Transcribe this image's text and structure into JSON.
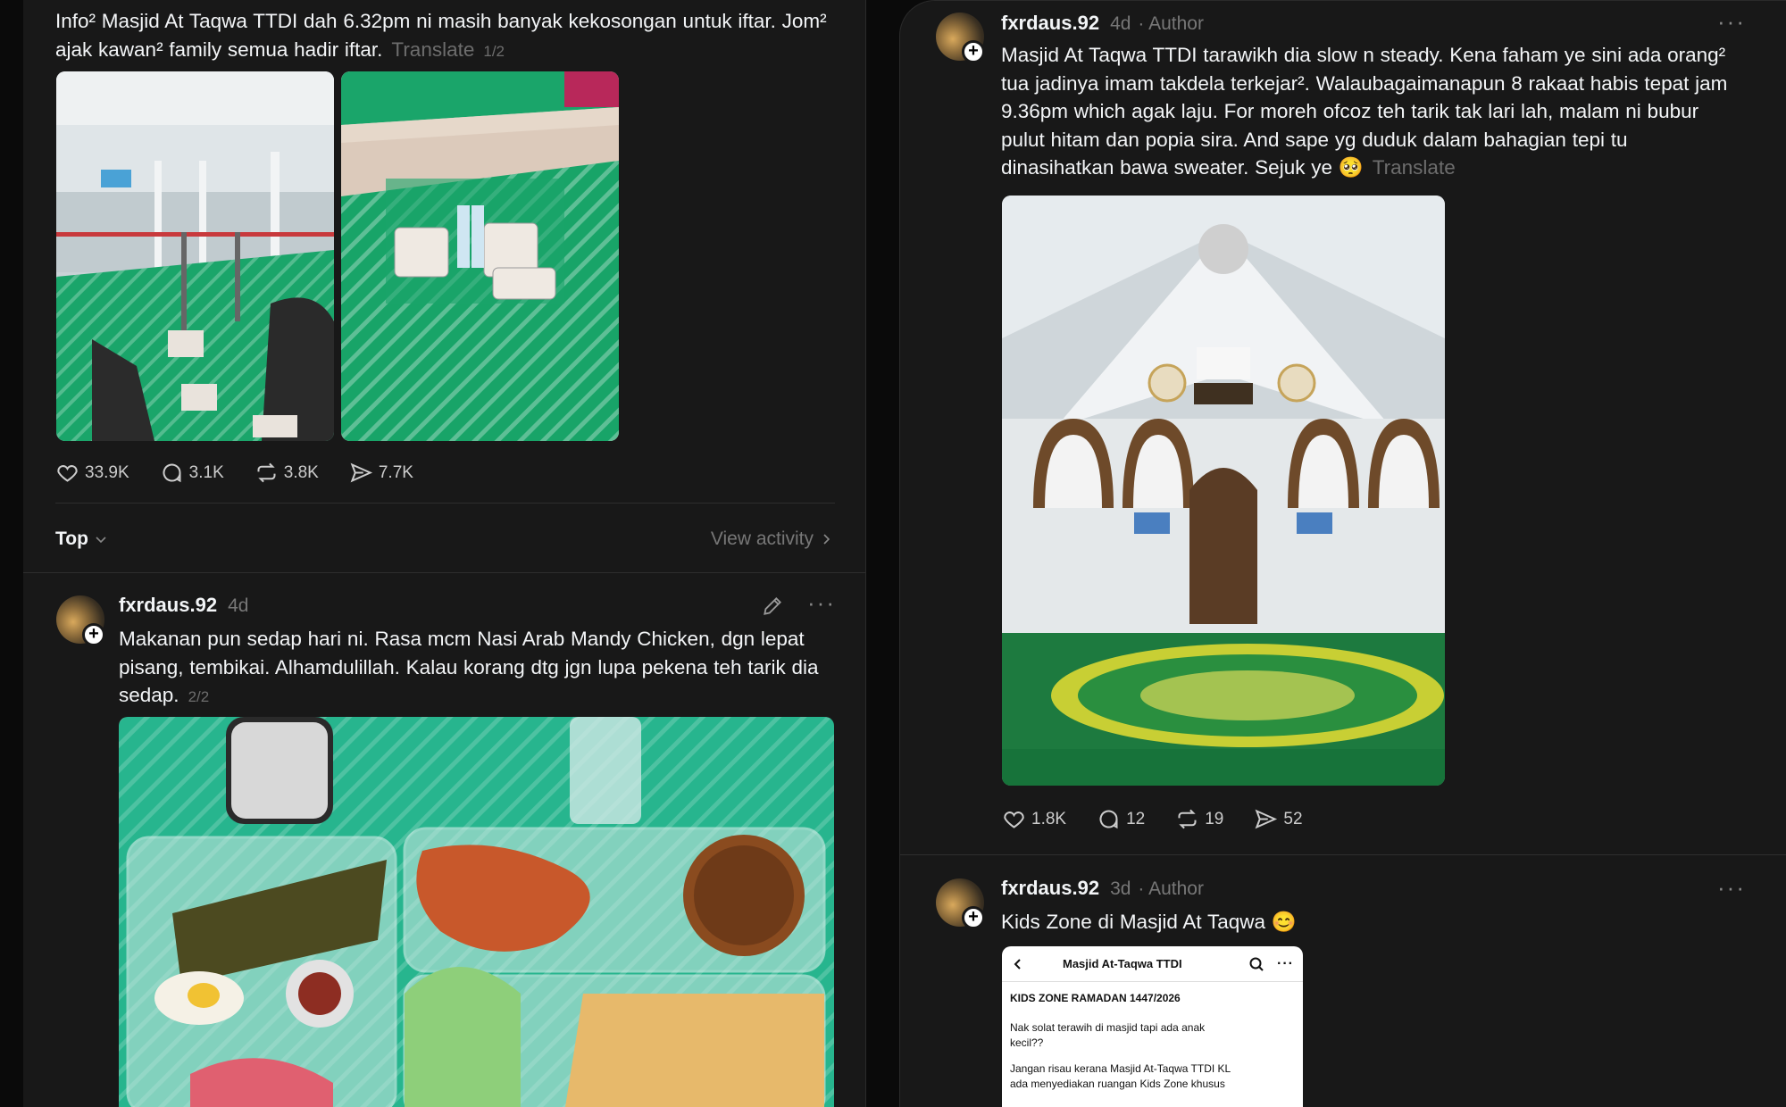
{
  "posts": {
    "p1": {
      "text_l1": "Info² Masjid At Taqwa TTDI dah 6.32pm ni masih banyak kekosongan untuk iftar. Jom²",
      "text_l2": "ajak kawan² family semua hadir iftar.",
      "translate": "Translate",
      "page": "1/2",
      "likes": "33.9K",
      "comments": "3.1K",
      "reposts": "3.8K",
      "shares": "7.7K"
    },
    "sort": {
      "label": "Top",
      "view_activity": "View activity"
    },
    "p2": {
      "username": "fxrdaus.92",
      "time": "4d",
      "text_l1": "Makanan pun sedap hari ni. Rasa mcm Nasi Arab Mandy Chicken, dgn lepat",
      "text_l2": "pisang, tembikai. Alhamdulillah. Kalau korang dtg jgn lupa pekena teh tarik dia",
      "text_l3": "sedap.",
      "page": "2/2"
    },
    "p3": {
      "username": "fxrdaus.92",
      "time": "4d",
      "author": "· Author",
      "text_l1": "Masjid At Taqwa TTDI tarawikh dia slow n steady. Kena faham ye sini ada orang²",
      "text_l2": "tua jadinya imam takdela terkejar². Walaubagaimanapun 8 rakaat habis tepat jam",
      "text_l3": "9.36pm which agak laju. For moreh ofcoz teh tarik tak lari lah, malam ni bubur",
      "text_l4": "pulut hitam dan popia sira. And sape yg duduk dalam bahagian tepi tu",
      "text_l5": "dinasihatkan bawa sweater. Sejuk ye 🥺",
      "translate": "Translate",
      "likes": "1.8K",
      "comments": "12",
      "reposts": "19",
      "shares": "52"
    },
    "p4": {
      "username": "fxrdaus.92",
      "time": "3d",
      "author": "· Author",
      "text": "Kids Zone di Masjid At Taqwa 😊",
      "shot": {
        "title": "Masjid At-Taqwa TTDI",
        "heading": "KIDS ZONE RAMADAN 1447/2026",
        "line1": "Nak solat terawih di masjid tapi ada anak",
        "line2": "kecil??",
        "line3": "Jangan risau kerana Masjid At-Taqwa TTDI KL",
        "line4": "ada menyediakan ruangan Kids Zone khusus"
      }
    }
  },
  "colors": {
    "bg": "#181818",
    "text": "#f3f5f7",
    "muted": "#777777",
    "mat_green": "#16a065"
  }
}
